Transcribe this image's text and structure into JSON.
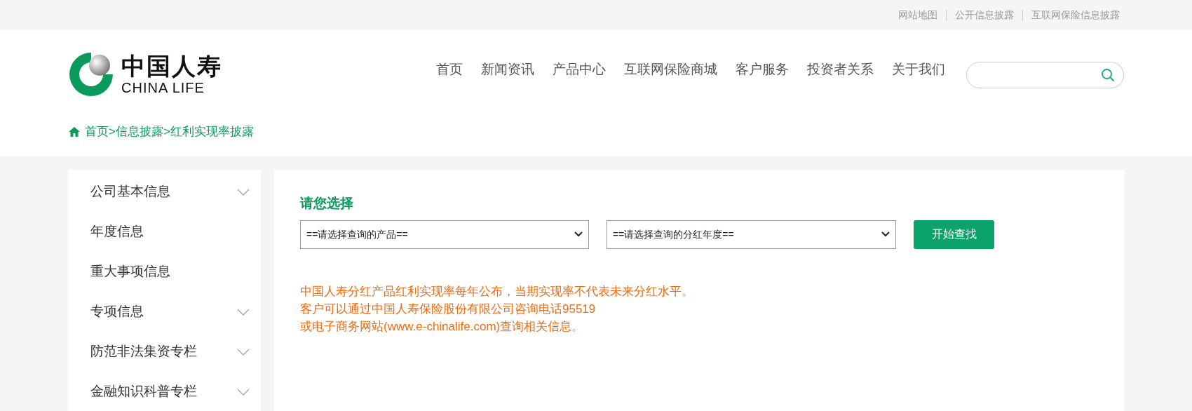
{
  "top_links": [
    "网站地图",
    "公开信息披露",
    "互联网保险信息披露"
  ],
  "logo": {
    "cn": "中国人寿",
    "en": "CHINA LIFE"
  },
  "nav": [
    "首页",
    "新闻资讯",
    "产品中心",
    "互联网保险商城",
    "客户服务",
    "投资者关系",
    "关于我们"
  ],
  "breadcrumb": "首页>信息披露>红利实现率披露",
  "sidebar": [
    {
      "label": "公司基本信息",
      "expandable": true
    },
    {
      "label": "年度信息",
      "expandable": false
    },
    {
      "label": "重大事项信息",
      "expandable": false
    },
    {
      "label": "专项信息",
      "expandable": true
    },
    {
      "label": "防范非法集资专栏",
      "expandable": true
    },
    {
      "label": "金融知识科普专栏",
      "expandable": true
    }
  ],
  "form": {
    "title": "请您选择",
    "product_select": "==请选择查询的产品==",
    "year_select": "==请选择查询的分红年度==",
    "button": "开始查找"
  },
  "notice": [
    "中国人寿分红产品红利实现率每年公布，当期实现率不代表未来分红水平。",
    "客户可以通过中国人寿保险股份有限公司咨询电话95519",
    "或电子商务网站(www.e-chinalife.com)查询相关信息。"
  ]
}
